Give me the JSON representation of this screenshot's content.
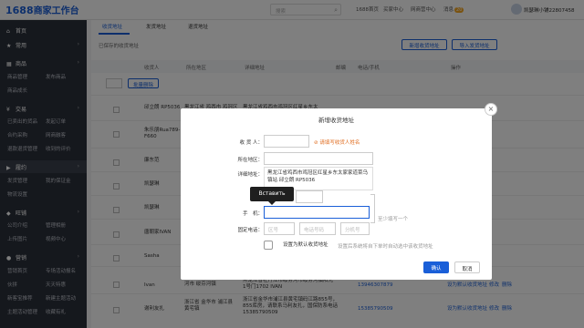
{
  "header": {
    "logo_num": "1688",
    "logo_text": "商家工作台",
    "search_placeholder": "搜索",
    "nav": [
      "1688首页",
      "买家中心",
      "网商营中心",
      "消息"
    ],
    "msg_badge": "20",
    "username": "凯瑟琳小铺22807458"
  },
  "sidebar": {
    "groups": [
      {
        "icon": "home-icon",
        "glyph": "⌂",
        "label": "首页"
      },
      {
        "icon": "star-icon",
        "glyph": "★",
        "label": "常用"
      },
      {
        "icon": "goods-icon",
        "glyph": "▦",
        "label": "商品"
      },
      {
        "icon": "trade-icon",
        "glyph": "¥",
        "label": "交易"
      },
      {
        "icon": "fulfill-icon",
        "glyph": "▶",
        "label": "履约"
      },
      {
        "icon": "shop-icon",
        "glyph": "◆",
        "label": "旺铺"
      },
      {
        "icon": "marketing-icon",
        "glyph": "●",
        "label": "营销"
      }
    ],
    "subs": {
      "goods": [
        "商品管理",
        "发布商品",
        "商品成长"
      ],
      "trade": [
        "已卖出的货品",
        "发起订单",
        "合约采购",
        "网商融客",
        "退款退货管理",
        "收到的评价"
      ],
      "fulfill": [
        "发货管理",
        "我的保证金",
        "物流设置"
      ],
      "shop": [
        "公司介绍",
        "管理相册",
        "上传图片",
        "视频中心"
      ],
      "marketing": [
        "营销首页",
        "专场活动报名",
        "伙拼",
        "天天特惠",
        "新客宝推荐",
        "新建主题活动",
        "主题活动管理",
        "收藏有礼"
      ]
    }
  },
  "main": {
    "tabs": [
      "收货地址",
      "发货地址",
      "退货地址"
    ],
    "saved_label": "已保存的收货地址",
    "btn_add": "新增收货地址",
    "btn_import": "导入发货地址",
    "columns": [
      "收货人",
      "所在地区",
      "详细地址",
      "邮编",
      "电话/手机",
      "操作"
    ],
    "btn_batch_delete": "批量删除",
    "rows": [
      {
        "name": "邱立朗 RP5036",
        "region": "黑龙江省 鸡西市 鸡冠区",
        "addr": "黑龙江省鸡西市鸡冠区红星乡东太"
      },
      {
        "name": "朱乐朋Rua789-F660",
        "region": "",
        "addr": ""
      },
      {
        "name": "廉东范",
        "region": "",
        "addr": ""
      },
      {
        "name": "凯瑟琳",
        "region": "",
        "addr": ""
      },
      {
        "name": "凯瑟琳",
        "region": "",
        "addr": ""
      },
      {
        "name": "唐朝家IVAN",
        "region": "",
        "addr": ""
      },
      {
        "name": "Sasha",
        "region": "",
        "addr": ""
      },
      {
        "name": "Ivan",
        "region": "黑龙江省 牡丹江市 绥芬河市 绥芬河镇",
        "addr": "黑龙江省牡丹江市绥芬河市绥芬河镇阳光1号门1702 IVAN",
        "phone": "13946307879",
        "ops": [
          "设为默认收货地址",
          "修改",
          "删除"
        ]
      },
      {
        "name": "谢利友扎",
        "region": "浙江省 金华市 浦江县 黄宅镇",
        "addr": "浙江省金华市浦江县黄宅镇码江路855号，855库房，请联系马利友扎，国保防系电话15385790509",
        "phone": "15385790509",
        "ops": [
          "设为默认收货地址",
          "修改",
          "删除"
        ]
      }
    ]
  },
  "modal": {
    "title": "新增收货地址",
    "label_receiver": "收 货 人：",
    "receiver_hint": "请填写收货人姓名",
    "label_region": "所在地区：",
    "label_address": "详细地址：",
    "address_value": "黑龙江省鸡西市鸡冠区红星乡东太家家道菜乌镇站 邱立朗 RP5036",
    "label_zip": "邮",
    "label_mobile": "手　机：",
    "label_phone": "固定电话：",
    "phone_ph_area": "区号",
    "phone_ph_num": "电话号码",
    "phone_ph_ext": "分机号",
    "at_least_one": "至少填写一个",
    "default_chk_label": "设置为默认收货地址",
    "default_hint": "设置后系统将自下单时自动选中该收货地址",
    "tooltip": "Вставить",
    "btn_ok": "确认",
    "btn_cancel": "取消"
  }
}
